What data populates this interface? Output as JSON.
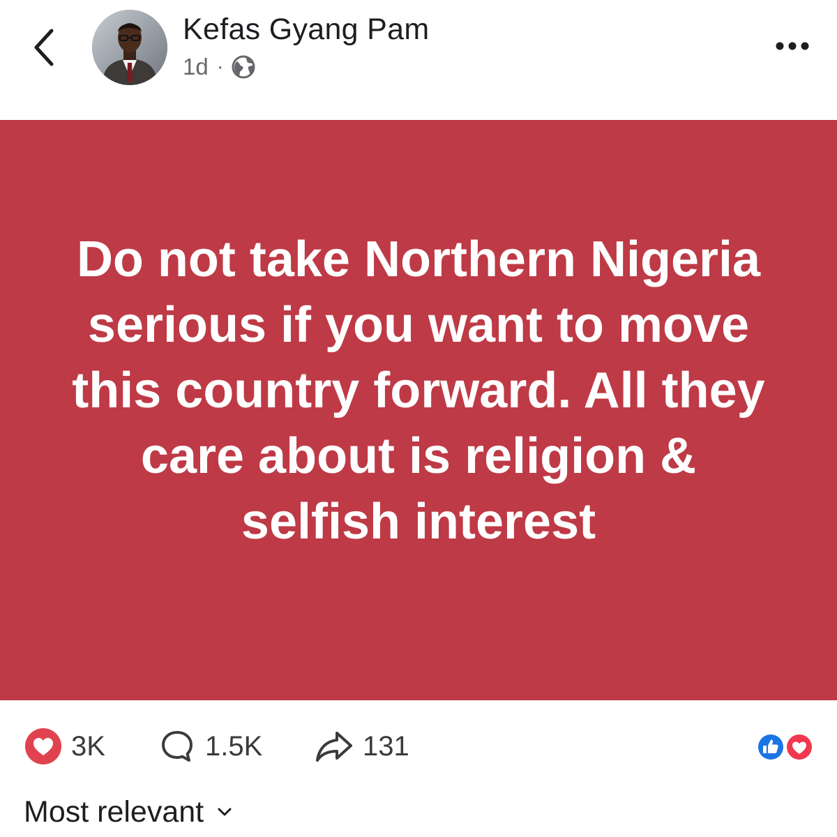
{
  "header": {
    "author_name": "Kefas Gyang Pam",
    "timestamp": "1d",
    "separator": "·",
    "audience_icon": "globe-icon",
    "back_icon": "chevron-left-icon",
    "more_icon": "more-horizontal-icon"
  },
  "post": {
    "background_color": "#be3a46",
    "text": "Do not take Northern Nigeria serious if you want to move this country forward. All they care about is religion & selfish interest"
  },
  "actions": {
    "reactions": {
      "icon": "heart-icon",
      "count": "3K",
      "color": "#e0434f"
    },
    "comments": {
      "icon": "comment-bubble-icon",
      "count": "1.5K"
    },
    "shares": {
      "icon": "share-arrow-icon",
      "count": "131"
    },
    "summary_icons": [
      "like-reaction-icon",
      "love-reaction-icon"
    ],
    "like_color": "#1b74e4",
    "love_color": "#f0384f"
  },
  "comments_sort": {
    "label": "Most relevant",
    "icon": "chevron-down-icon"
  }
}
